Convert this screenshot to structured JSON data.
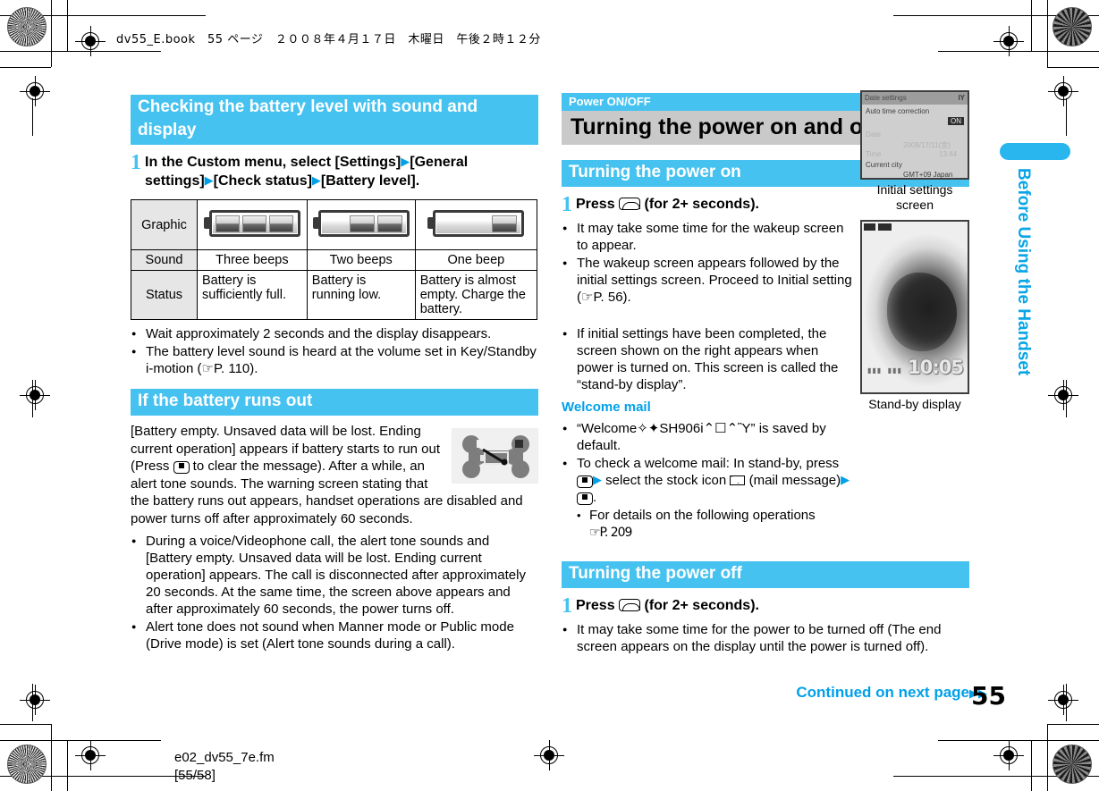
{
  "header": {
    "print_info": "dv55_E.book　55 ページ　２００８年４月１７日　木曜日　午後２時１２分"
  },
  "footer": {
    "file_name": "e02_dv55_7e.fm",
    "page_range": "[55/58]",
    "continued_label": "Continued on next page",
    "continued_arrow": "▶▶",
    "page_number": "55"
  },
  "sidebar": {
    "chapter_label": "Before Using the Handset",
    "tab_color": "#29b6ef",
    "text_color": "#0aa5e6"
  },
  "colors": {
    "accent_blue": "#46c2f0",
    "link_blue": "#00a0e9",
    "gray_bar": "#c9c9c9"
  },
  "left_column": {
    "section1": {
      "heading": "Checking the battery level with sound and display",
      "step": {
        "number": "1",
        "parts": [
          "In the Custom menu, select [Settings]",
          "[General settings]",
          "[Check status]",
          "[Battery level]."
        ],
        "arrow": "▶"
      },
      "table": {
        "row_labels": [
          "Graphic",
          "Sound",
          "Status"
        ],
        "graphics": [
          "battery-full-icon",
          "battery-low-icon",
          "battery-empty-icon"
        ],
        "graphic_segments": [
          3,
          2,
          1
        ],
        "sound": [
          "Three beeps",
          "Two beeps",
          "One beep"
        ],
        "status": [
          "Battery is sufficiently full.",
          "Battery is running low.",
          "Battery is almost empty. Charge the battery."
        ]
      },
      "notes": [
        "Wait approximately 2 seconds and the display disappears.",
        "The battery level sound is heard at the volume set in Key/Standby i-motion (☞P. 110)."
      ]
    },
    "section2": {
      "heading": "If the battery runs out",
      "image_name": "battery-empty-crossed-bones-icon",
      "paragraph_a": "[Battery empty. Unsaved data will be lost. Ending current operation] appears if battery starts to run out (Press ",
      "paragraph_b": " to clear the message). After a while, an alert tone sounds. The warning screen stating that the battery runs out appears, handset operations are disabled and power turns off after approximately 60 seconds.",
      "notes": [
        "During a voice/Videophone call, the alert tone sounds and [Battery empty. Unsaved data will be lost. Ending current operation] appears. The call is disconnected after approximately 20 seconds. At the same time, the screen above appears and after approximately 60 seconds, the power turns off.",
        "Alert tone does not sound when Manner mode or Public mode (Drive mode) is set (Alert tone sounds during a call)."
      ]
    }
  },
  "right_column": {
    "eyebrow": "Power ON/OFF",
    "title": "Turning the power on and off",
    "power_on": {
      "heading": "Turning the power on",
      "step": {
        "number": "1",
        "text_before_key": "Press",
        "key_name": "call-end-key",
        "text_after_key": "(for 2+ seconds)."
      },
      "notes": [
        "It may take some time for the wakeup screen to appear.",
        "The wakeup screen appears followed by the initial settings screen. Proceed to Initial setting (☞P. 56).",
        "If initial settings have been completed, the screen shown on the right appears when power is turned on. This screen is called the “stand-by display”."
      ],
      "welcome_mail": {
        "heading": "Welcome mail",
        "notes": [
          "“Welcome✧✦SH906i⌃☐⌃Ὓ” is saved by default.",
          "To check a welcome mail: In stand-by, press"
        ],
        "note2_mid": "select the stock icon",
        "note2_tail": "(mail message)",
        "subnote": "For details on the following operations",
        "subnote_ref": "☞P. 209"
      },
      "screenshots": [
        {
          "name": "initial-settings-screen",
          "caption": "Initial settings screen",
          "title": "Date settings",
          "title_right": "IY",
          "lines": [
            "Auto time correction",
            "Date",
            "Time",
            "Current city"
          ],
          "dim_values": [
            "2008/17/11(金)",
            "13:44"
          ],
          "selected_value": "ON",
          "city_value": "GMT+09 Japan"
        },
        {
          "name": "stand-by-display",
          "caption": "Stand-by display",
          "clock": "10:05",
          "status_left": "signal-icon",
          "status_right": "battery-icon"
        }
      ]
    },
    "power_off": {
      "heading": "Turning the power off",
      "step": {
        "number": "1",
        "text_before_key": "Press",
        "key_name": "call-end-key",
        "text_after_key": "(for 2+ seconds)."
      },
      "notes": [
        "It may take some time for the power to be turned off (The end screen appears on the display until the power is turned off)."
      ]
    }
  }
}
